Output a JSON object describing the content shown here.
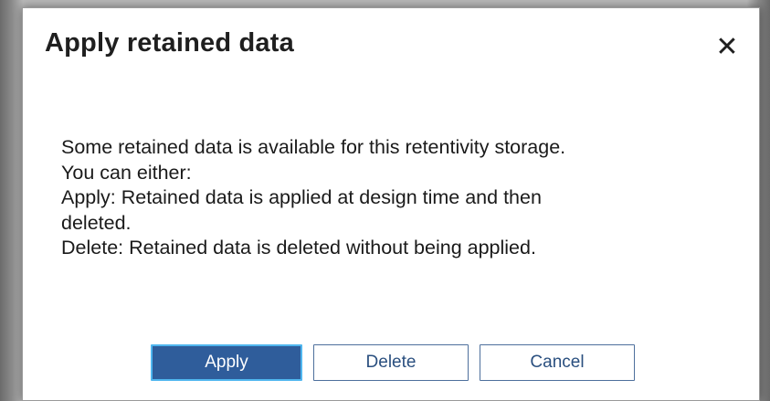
{
  "dialog": {
    "title": "Apply retained data",
    "close_icon": "close-icon",
    "close_glyph": "✕",
    "message_lines": [
      "Some retained data is available for this retentivity storage.",
      "You can either:",
      "Apply: Retained data is applied at design time and then",
      "deleted.",
      "Delete: Retained data is deleted without being applied."
    ],
    "buttons": {
      "apply": "Apply",
      "delete": "Delete",
      "cancel": "Cancel"
    }
  },
  "colors": {
    "primary_button": "#2f5d9b",
    "focus_border": "#4fb6ef",
    "secondary_text": "#2a4f7f"
  }
}
